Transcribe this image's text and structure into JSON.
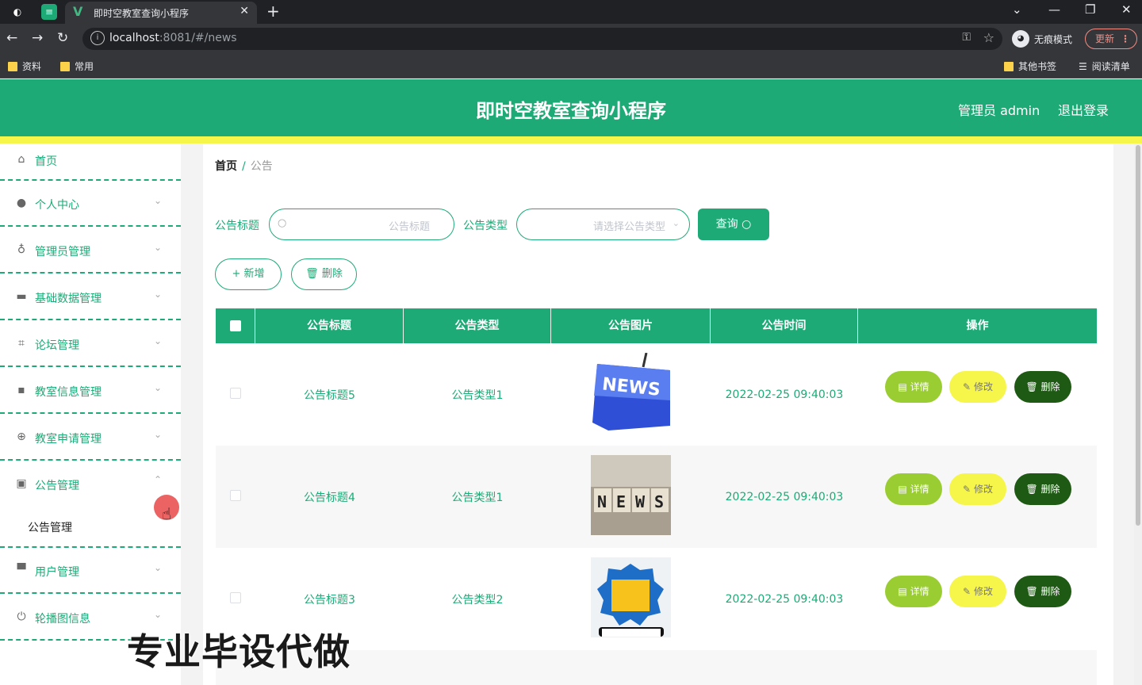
{
  "browser": {
    "tab_title": "即时空教室查询小程序",
    "url_host": "localhost",
    "url_rest": ":8081/#/news",
    "incognito_label": "无痕模式",
    "update_label": "更新",
    "bookmarks": [
      "资料",
      "常用"
    ],
    "other_bookmarks": "其他书签",
    "reading_list": "阅读清单"
  },
  "header": {
    "title": "即时空教室查询小程序",
    "user": "管理员 admin",
    "logout": "退出登录",
    "brand_color": "#1eaa77",
    "accent_color": "#f5f54a"
  },
  "sidebar": {
    "items": [
      {
        "label": "首页",
        "icon": "home-icon"
      },
      {
        "label": "个人中心",
        "icon": "user-icon"
      },
      {
        "label": "管理员管理",
        "icon": "microphone-icon"
      },
      {
        "label": "基础数据管理",
        "icon": "briefcase-icon"
      },
      {
        "label": "论坛管理",
        "icon": "crop-icon"
      },
      {
        "label": "教室信息管理",
        "icon": "chat-icon"
      },
      {
        "label": "教室申请管理",
        "icon": "compass-icon"
      },
      {
        "label": "公告管理",
        "icon": "camera-icon"
      },
      {
        "label": "用户管理",
        "icon": "monitor-icon"
      },
      {
        "label": "轮播图信息",
        "icon": "power-icon"
      }
    ],
    "sub_item": "公告管理"
  },
  "breadcrumb": {
    "home": "首页",
    "sep": "/",
    "current": "公告"
  },
  "search": {
    "title_label": "公告标题",
    "title_placeholder": "公告标题",
    "type_label": "公告类型",
    "type_placeholder": "请选择公告类型",
    "query_button": "查询"
  },
  "actions": {
    "add": "新增",
    "delete": "删除"
  },
  "table": {
    "headers": [
      "公告标题",
      "公告类型",
      "公告图片",
      "公告时间",
      "操作"
    ],
    "rows": [
      {
        "title": "公告标题5",
        "type": "公告类型1",
        "time": "2022-02-25 09:40:03",
        "image": "news-keyboard-image"
      },
      {
        "title": "公告标题4",
        "type": "公告类型1",
        "time": "2022-02-25 09:40:03",
        "image": "news-blocks-image"
      },
      {
        "title": "公告标题3",
        "type": "公告类型2",
        "time": "2022-02-25 09:40:03",
        "image": "hot-news-phone-image"
      }
    ],
    "row_buttons": {
      "detail": "详情",
      "edit": "修改",
      "delete": "删除"
    }
  },
  "watermark": "专业毕设代做"
}
